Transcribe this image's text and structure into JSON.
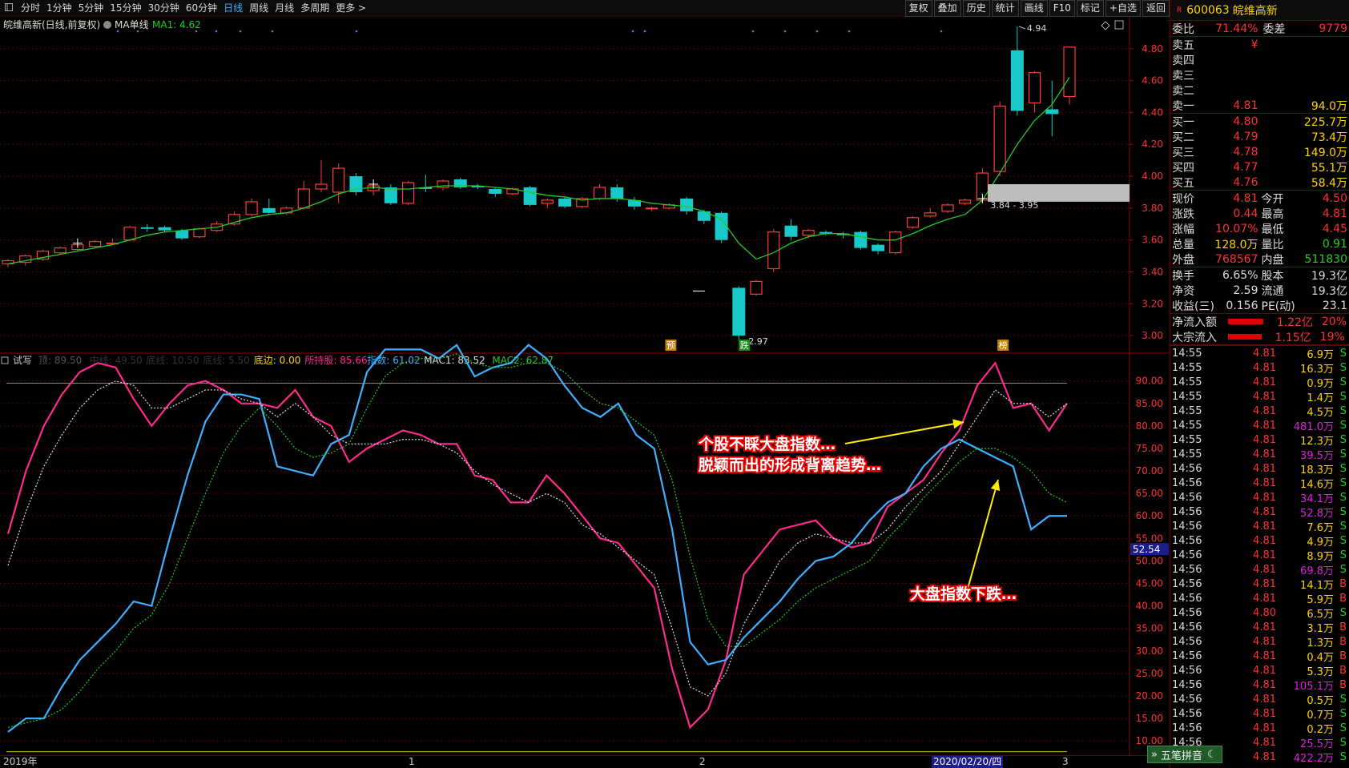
{
  "topbar": {
    "items": [
      "分时",
      "1分钟",
      "5分钟",
      "15分钟",
      "30分钟",
      "60分钟",
      "日线",
      "周线",
      "月线",
      "多周期",
      "更多 >"
    ],
    "active": "日线"
  },
  "toolbar": {
    "buttons": [
      "复权",
      "叠加",
      "历史",
      "统计",
      "画线",
      "F10",
      "标记",
      "+自选",
      "返回"
    ]
  },
  "main_title": "皖维高新(日线,前复权)",
  "ma_label": "MA单线",
  "ma_value": "MA1: 4.62",
  "sub_indicators": [
    {
      "text": "试写",
      "color": "#cccccc"
    },
    {
      "text": "顶: 89.50",
      "color": "#555555"
    },
    {
      "text": "中线: 49.50",
      "color": "#333333"
    },
    {
      "text": "底线: 10.50",
      "color": "#333333"
    },
    {
      "text": "底线: 5.50",
      "color": "#333333"
    },
    {
      "text": "底边: 0.00",
      "color": "#ffd400"
    },
    {
      "text": "所持股: 85.66",
      "color": "#ff2a8e"
    },
    {
      "text": "指数: 61.02",
      "color": "#3fb0ff"
    },
    {
      "text": "MAC1: 83.52",
      "color": "#dddddd"
    },
    {
      "text": "MAC2: 62.87",
      "color": "#22cc22"
    }
  ],
  "price_axis": [
    "4.80",
    "4.60",
    "4.40",
    "4.20",
    "4.00",
    "3.80",
    "3.60",
    "3.40",
    "3.20",
    "3.00"
  ],
  "osc_axis": [
    "90.00",
    "85.00",
    "80.00",
    "75.00",
    "70.00",
    "65.00",
    "60.00",
    "55.00",
    "50.00",
    "45.00",
    "40.00",
    "35.00",
    "30.00",
    "25.00",
    "20.00",
    "15.00",
    "10.00"
  ],
  "cursor_value": "52.54",
  "chart_marks": {
    "high": "4.94",
    "low": "2.97",
    "range": "3.84 - 3.95"
  },
  "event_labels": [
    "预",
    "跌",
    "榜"
  ],
  "annotations": {
    "line1": "个股不睬大盘指数…",
    "line2": "脱颖而出的形成背离趋势…",
    "line3": "大盘指数下跌…"
  },
  "date_axis": [
    "2019年",
    "1",
    "2",
    "2020/02/20/四",
    "3"
  ],
  "stock": {
    "code": "600063",
    "name": "皖维高新",
    "r": "R"
  },
  "quote": {
    "weibi_label": "委比",
    "weibi": "71.44%",
    "weicha_label": "委差",
    "weicha": "9779",
    "sell": [
      {
        "label": "卖五",
        "price": "¥",
        "vol": ""
      },
      {
        "label": "卖四",
        "price": "",
        "vol": ""
      },
      {
        "label": "卖三",
        "price": "",
        "vol": ""
      },
      {
        "label": "卖二",
        "price": "",
        "vol": ""
      },
      {
        "label": "卖一",
        "price": "4.81",
        "vol": "94.0万"
      }
    ],
    "buy": [
      {
        "label": "买一",
        "price": "4.80",
        "vol": "225.7万"
      },
      {
        "label": "买二",
        "price": "4.79",
        "vol": "73.4万"
      },
      {
        "label": "买三",
        "price": "4.78",
        "vol": "149.0万"
      },
      {
        "label": "买四",
        "price": "4.77",
        "vol": "55.1万"
      },
      {
        "label": "买五",
        "price": "4.76",
        "vol": "58.4万"
      }
    ],
    "stats": [
      {
        "l1": "现价",
        "v1": "4.81",
        "c1": "red",
        "l2": "今开",
        "v2": "4.50",
        "c2": "red"
      },
      {
        "l1": "涨跌",
        "v1": "0.44",
        "c1": "red",
        "l2": "最高",
        "v2": "4.81",
        "c2": "red"
      },
      {
        "l1": "涨幅",
        "v1": "10.07%",
        "c1": "red",
        "l2": "最低",
        "v2": "4.45",
        "c2": "red"
      },
      {
        "l1": "总量",
        "v1": "128.0万",
        "c1": "ylw",
        "l2": "量比",
        "v2": "0.91",
        "c2": "grn"
      },
      {
        "l1": "外盘",
        "v1": "768567",
        "c1": "red",
        "l2": "内盘",
        "v2": "511830",
        "c2": "grn"
      }
    ],
    "stats2": [
      {
        "l1": "换手",
        "v1": "6.65%",
        "l2": "股本",
        "v2": "19.3亿"
      },
      {
        "l1": "净资",
        "v1": "2.59",
        "l2": "流通",
        "v2": "19.3亿"
      },
      {
        "l1": "收益(三)",
        "v1": "0.156",
        "l2": "PE(动)",
        "v2": "23.1"
      }
    ],
    "flows": [
      {
        "label": "净流入额",
        "value": "1.22亿",
        "pct": "20%",
        "bar": 0.2
      },
      {
        "label": "大宗流入",
        "value": "1.15亿",
        "pct": "19%",
        "bar": 0.19
      }
    ]
  },
  "ticks": [
    [
      "14:55",
      "4.81",
      "6.9万",
      "S"
    ],
    [
      "14:55",
      "4.81",
      "16.3万",
      "S"
    ],
    [
      "14:55",
      "4.81",
      "0.9万",
      "S"
    ],
    [
      "14:55",
      "4.81",
      "1.4万",
      "S"
    ],
    [
      "14:55",
      "4.81",
      "4.5万",
      "S"
    ],
    [
      "14:55",
      "4.81",
      "481.0万",
      "S"
    ],
    [
      "14:55",
      "4.81",
      "12.3万",
      "S"
    ],
    [
      "14:55",
      "4.81",
      "39.5万",
      "S"
    ],
    [
      "14:56",
      "4.81",
      "18.3万",
      "S"
    ],
    [
      "14:56",
      "4.81",
      "14.6万",
      "S"
    ],
    [
      "14:56",
      "4.81",
      "34.1万",
      "S"
    ],
    [
      "14:56",
      "4.81",
      "52.8万",
      "S"
    ],
    [
      "14:56",
      "4.81",
      "7.6万",
      "S"
    ],
    [
      "14:56",
      "4.81",
      "4.9万",
      "S"
    ],
    [
      "14:56",
      "4.81",
      "8.9万",
      "S"
    ],
    [
      "14:56",
      "4.81",
      "69.8万",
      "S"
    ],
    [
      "14:56",
      "4.81",
      "14.1万",
      "B"
    ],
    [
      "14:56",
      "4.81",
      "5.9万",
      "B"
    ],
    [
      "14:56",
      "4.80",
      "6.5万",
      "S"
    ],
    [
      "14:56",
      "4.81",
      "3.1万",
      "B"
    ],
    [
      "14:56",
      "4.81",
      "1.3万",
      "B"
    ],
    [
      "14:56",
      "4.81",
      "0.4万",
      "B"
    ],
    [
      "14:56",
      "4.81",
      "5.3万",
      "B"
    ],
    [
      "14:56",
      "4.81",
      "105.1万",
      "B"
    ],
    [
      "14:56",
      "4.81",
      "0.5万",
      "S"
    ],
    [
      "14:56",
      "4.81",
      "0.7万",
      "S"
    ],
    [
      "14:56",
      "4.81",
      "0.2万",
      "S"
    ],
    [
      "14:56",
      "4.81",
      "25.5万",
      "S"
    ],
    [
      "14:56",
      "4.81",
      "422.2万",
      "S"
    ]
  ],
  "ime": "五笔拼音",
  "chart_data": [
    {
      "type": "candlestick",
      "title": "皖维高新(日线,前复权)",
      "ylim": [
        2.9,
        5.0
      ],
      "ohlc": [
        [
          3.45,
          3.47,
          3.43,
          3.48
        ],
        [
          3.46,
          3.5,
          3.44,
          3.51
        ],
        [
          3.48,
          3.53,
          3.47,
          3.54
        ],
        [
          3.52,
          3.55,
          3.51,
          3.56
        ],
        [
          3.54,
          3.57,
          3.53,
          3.58
        ],
        [
          3.56,
          3.59,
          3.55,
          3.6
        ],
        [
          3.58,
          3.58,
          3.57,
          3.61
        ],
        [
          3.6,
          3.68,
          3.59,
          3.69
        ],
        [
          3.68,
          3.67,
          3.65,
          3.7
        ],
        [
          3.68,
          3.66,
          3.65,
          3.69
        ],
        [
          3.66,
          3.61,
          3.6,
          3.67
        ],
        [
          3.62,
          3.67,
          3.61,
          3.68
        ],
        [
          3.66,
          3.7,
          3.65,
          3.72
        ],
        [
          3.7,
          3.76,
          3.69,
          3.78
        ],
        [
          3.76,
          3.84,
          3.75,
          3.86
        ],
        [
          3.8,
          3.77,
          3.76,
          3.86
        ],
        [
          3.77,
          3.8,
          3.76,
          3.81
        ],
        [
          3.8,
          3.92,
          3.79,
          3.97
        ],
        [
          3.92,
          3.95,
          3.9,
          4.1
        ],
        [
          3.9,
          4.05,
          3.83,
          4.08
        ],
        [
          4.0,
          3.9,
          3.88,
          4.02
        ],
        [
          3.91,
          3.94,
          3.88,
          3.96
        ],
        [
          3.93,
          3.83,
          3.82,
          3.95
        ],
        [
          3.83,
          3.96,
          3.82,
          3.97
        ],
        [
          3.93,
          3.92,
          3.9,
          4.01
        ],
        [
          3.93,
          3.97,
          3.91,
          3.98
        ],
        [
          3.98,
          3.93,
          3.92,
          3.99
        ],
        [
          3.94,
          3.93,
          3.92,
          3.95
        ],
        [
          3.92,
          3.89,
          3.87,
          3.93
        ],
        [
          3.89,
          3.92,
          3.88,
          3.93
        ],
        [
          3.93,
          3.82,
          3.81,
          3.94
        ],
        [
          3.83,
          3.85,
          3.8,
          3.86
        ],
        [
          3.86,
          3.81,
          3.8,
          3.87
        ],
        [
          3.81,
          3.86,
          3.8,
          3.87
        ],
        [
          3.86,
          3.93,
          3.85,
          3.95
        ],
        [
          3.93,
          3.86,
          3.84,
          3.95
        ],
        [
          3.85,
          3.81,
          3.79,
          3.87
        ],
        [
          3.8,
          3.8,
          3.78,
          3.81
        ],
        [
          3.8,
          3.82,
          3.79,
          3.83
        ],
        [
          3.86,
          3.78,
          3.76,
          3.87
        ],
        [
          3.78,
          3.72,
          3.7,
          3.79
        ],
        [
          3.77,
          3.6,
          3.58,
          3.78
        ],
        [
          3.3,
          3.0,
          2.97,
          3.31
        ],
        [
          3.26,
          3.34,
          3.25,
          3.35
        ],
        [
          3.42,
          3.65,
          3.4,
          3.67
        ],
        [
          3.69,
          3.62,
          3.6,
          3.73
        ],
        [
          3.63,
          3.66,
          3.61,
          3.67
        ],
        [
          3.65,
          3.64,
          3.63,
          3.66
        ],
        [
          3.64,
          3.63,
          3.61,
          3.65
        ],
        [
          3.65,
          3.55,
          3.54,
          3.66
        ],
        [
          3.57,
          3.53,
          3.51,
          3.58
        ],
        [
          3.52,
          3.65,
          3.51,
          3.66
        ],
        [
          3.68,
          3.74,
          3.67,
          3.75
        ],
        [
          3.75,
          3.77,
          3.74,
          3.8
        ],
        [
          3.78,
          3.82,
          3.77,
          3.83
        ],
        [
          3.83,
          3.85,
          3.82,
          3.86
        ],
        [
          3.85,
          4.02,
          3.84,
          4.05
        ],
        [
          4.03,
          4.44,
          4.0,
          4.47
        ],
        [
          4.79,
          4.41,
          4.38,
          4.94
        ],
        [
          4.46,
          4.65,
          4.4,
          4.66
        ],
        [
          4.42,
          4.39,
          4.25,
          4.6
        ],
        [
          4.5,
          4.81,
          4.45,
          4.81
        ]
      ],
      "ma": [
        3.45,
        3.47,
        3.49,
        3.51,
        3.53,
        3.55,
        3.57,
        3.6,
        3.63,
        3.65,
        3.66,
        3.67,
        3.68,
        3.71,
        3.74,
        3.76,
        3.77,
        3.8,
        3.84,
        3.89,
        3.92,
        3.93,
        3.92,
        3.92,
        3.93,
        3.94,
        3.94,
        3.94,
        3.93,
        3.92,
        3.9,
        3.88,
        3.87,
        3.85,
        3.86,
        3.86,
        3.85,
        3.83,
        3.82,
        3.81,
        3.78,
        3.73,
        3.58,
        3.48,
        3.52,
        3.58,
        3.62,
        3.64,
        3.64,
        3.62,
        3.6,
        3.6,
        3.64,
        3.69,
        3.73,
        3.76,
        3.85,
        4.02,
        4.2,
        4.35,
        4.45,
        4.62
      ]
    },
    {
      "type": "line",
      "ylim": [
        7,
        96
      ],
      "series": [
        {
          "name": "所持股",
          "color": "#ff2a8e",
          "values": [
            56,
            70,
            80,
            87,
            92,
            94,
            93,
            86,
            80,
            85,
            89,
            90,
            88,
            85,
            85,
            84,
            88,
            82,
            80,
            72,
            75,
            77,
            79,
            78,
            76,
            76,
            69,
            68,
            63,
            63,
            69,
            65,
            60,
            55,
            54,
            49,
            44,
            26,
            13,
            17,
            28,
            47,
            52,
            57,
            58,
            59,
            55,
            53,
            54,
            62,
            65,
            68,
            74,
            79,
            89,
            94,
            84,
            85,
            79,
            85
          ],
          "values_len_note": ""
        },
        {
          "name": "指数",
          "color": "#3fb0ff",
          "values": [
            12,
            15,
            15,
            22,
            28,
            32,
            36,
            41,
            40,
            55,
            69,
            81,
            87,
            87,
            86,
            71,
            70,
            69,
            76,
            78,
            92,
            97,
            97,
            97,
            95,
            98,
            91,
            93,
            94,
            98,
            95,
            89,
            84,
            82,
            85,
            78,
            75,
            57,
            32,
            27,
            28,
            33,
            37,
            41,
            46,
            50,
            51,
            54,
            59,
            63,
            65,
            71,
            75,
            77,
            75,
            73,
            71,
            57,
            60,
            60
          ]
        },
        {
          "name": "MAC1",
          "color": "#dddddd",
          "values": [
            49,
            61,
            71,
            78,
            84,
            88,
            90,
            89,
            84,
            84,
            86,
            88,
            88,
            86,
            85,
            82,
            85,
            82,
            78,
            76,
            76,
            76,
            77,
            77,
            76,
            74,
            70,
            67,
            65,
            63,
            65,
            63,
            58,
            56,
            53,
            50,
            47,
            35,
            22,
            20,
            25,
            36,
            43,
            50,
            54,
            56,
            55,
            54,
            54,
            57,
            62,
            66,
            70,
            76,
            82,
            88,
            85,
            85,
            82,
            85
          ]
        },
        {
          "name": "MAC2",
          "color": "#22cc22",
          "values": [
            13,
            14,
            15,
            17,
            21,
            26,
            30,
            35,
            38,
            45,
            55,
            65,
            74,
            80,
            84,
            80,
            75,
            73,
            74,
            76,
            84,
            91,
            94,
            95,
            95,
            96,
            94,
            93,
            93,
            94,
            94,
            92,
            88,
            85,
            84,
            81,
            78,
            68,
            51,
            37,
            31,
            31,
            34,
            37,
            41,
            44,
            46,
            48,
            50,
            55,
            59,
            64,
            68,
            72,
            75,
            75,
            73,
            70,
            65,
            63
          ]
        }
      ]
    }
  ]
}
